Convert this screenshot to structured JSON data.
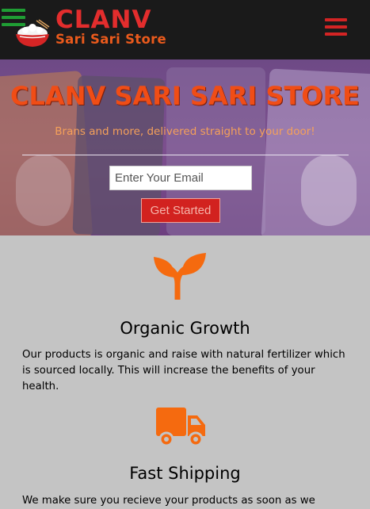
{
  "navbar": {
    "brand_name": "CLANV",
    "brand_tagline": "Sari Sari Store",
    "colors": {
      "background": "#1a1a1a",
      "brand_red": "#e32d2d",
      "tagline_orange": "#ea5a1c",
      "left_menu": "#1f9d34",
      "right_menu": "#d32424"
    },
    "icons": {
      "left": "hamburger-menu-icon",
      "logo": "rice-bowl-logo-icon",
      "right": "hamburger-menu-icon"
    }
  },
  "hero": {
    "title": "CLANV SARI SARI STORE",
    "subtitle": "Brans and more, delivered straight to your door!",
    "email_placeholder": "Enter Your Email",
    "cta_label": "Get Started",
    "colors": {
      "title": "#f04d16",
      "subtitle": "#f5a05a",
      "cta_bg": "#d2221f"
    }
  },
  "features": [
    {
      "icon": "sprout-icon",
      "title": "Organic Growth",
      "text": "Our products is organic and raise with natural fertilizer which is sourced locally. This will increase the benefits of your health."
    },
    {
      "icon": "truck-icon",
      "title": "Fast Shipping",
      "text": "We make sure you recieve your products as soon as we"
    }
  ],
  "accent_color": "#f56a0f",
  "section_background": "#c4c4c4"
}
